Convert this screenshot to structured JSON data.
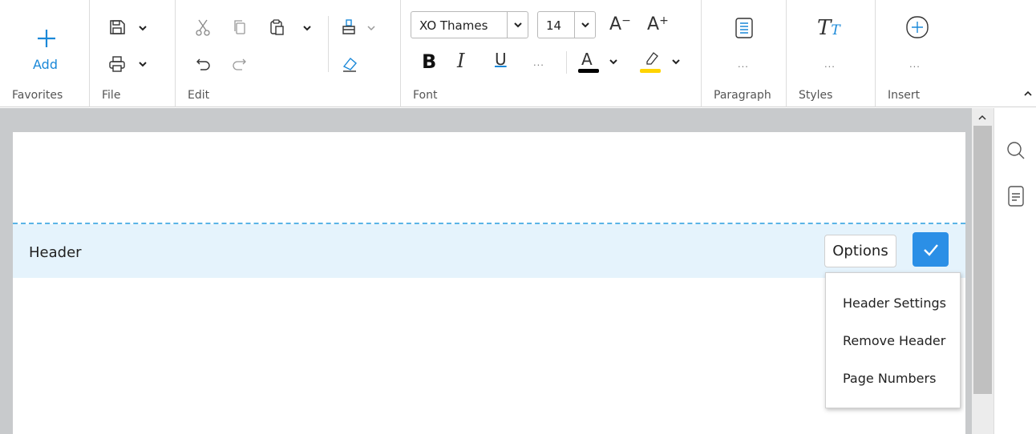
{
  "ribbon": {
    "favorites": {
      "label": "Favorites",
      "add_label": "Add"
    },
    "file": {
      "label": "File"
    },
    "edit": {
      "label": "Edit"
    },
    "font": {
      "label": "Font",
      "font_name": "XO Thames",
      "font_size": "14",
      "more": "..."
    },
    "paragraph": {
      "label": "Paragraph",
      "more": "..."
    },
    "styles": {
      "label": "Styles",
      "more": "..."
    },
    "insert": {
      "label": "Insert",
      "more": "..."
    }
  },
  "colors": {
    "accent": "#2b8fe6",
    "font_color_bar": "#000000",
    "highlight_bar": "#ffd400",
    "header_band": "#e5f3fc",
    "dashed_line": "#5ab4e6"
  },
  "document": {
    "header_label": "Header",
    "options_label": "Options"
  },
  "menu": {
    "items": [
      {
        "label": "Header Settings"
      },
      {
        "label": "Remove Header"
      },
      {
        "label": "Page Numbers"
      }
    ]
  },
  "icons": {
    "add": "plus-icon",
    "save": "save-icon",
    "print": "print-icon",
    "cut": "scissors-icon",
    "copy": "copy-icon",
    "paste": "paste-icon",
    "undo": "undo-icon",
    "redo": "redo-icon",
    "format_painter": "brush-icon",
    "eraser": "eraser-icon",
    "search": "search-icon",
    "notes": "notes-icon"
  }
}
